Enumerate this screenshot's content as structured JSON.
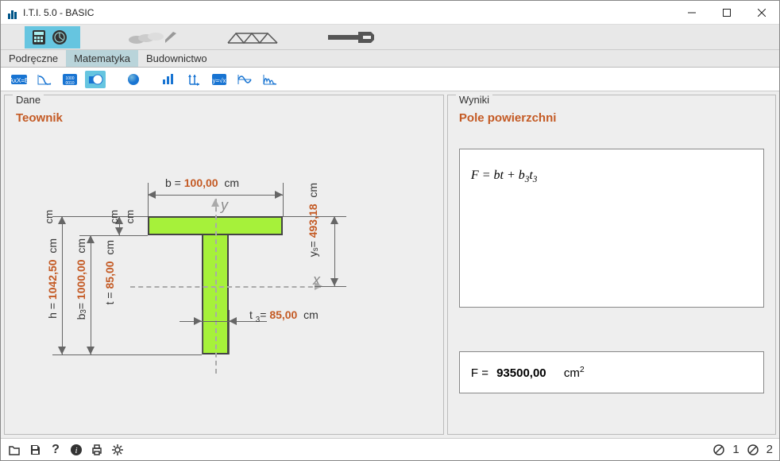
{
  "window": {
    "title": "I.T.I. 5.0 - BASIC"
  },
  "tabs": {
    "t1": "Podręczne",
    "t2": "Matematyka",
    "t3": "Budownictwo"
  },
  "left": {
    "legend": "Dane",
    "title": "Teownik",
    "dims": {
      "b_label": "b  =",
      "b": "100,00",
      "b_unit": "cm",
      "h_label": "h =",
      "h": "1042,50",
      "h_unit": "cm",
      "b3_label": "b₃=",
      "b3": "1000,00",
      "b3_unit": "cm",
      "t_label": "t =",
      "t": "85,00",
      "t_unit": "cm",
      "t3_label": "t ₃=",
      "t3": "85,00",
      "t3_unit": "cm",
      "ys_label": "yₛ=",
      "ys": "493,18",
      "ys_unit": "cm",
      "y_axis": "y",
      "x_axis": "x"
    }
  },
  "right": {
    "legend": "Wyniki",
    "title": "Pole powierzchni",
    "formula": "F = bt + b₃t₃",
    "result": {
      "label": "F  =",
      "value": "93500,00",
      "unit": "cm²"
    }
  },
  "status": {
    "s1": "1",
    "s2": "2"
  }
}
